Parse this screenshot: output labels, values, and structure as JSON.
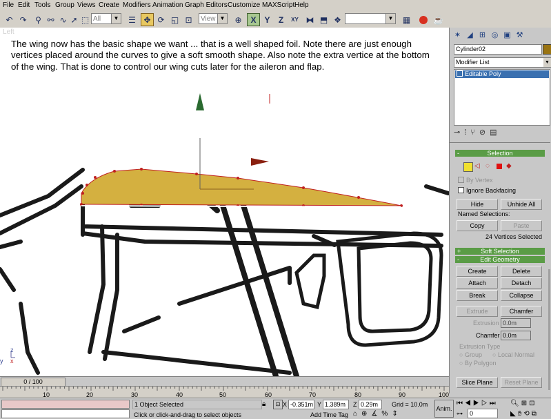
{
  "menu": [
    "File",
    "Edit",
    "Tools",
    "Group",
    "Views",
    "Create",
    "Modifiers",
    "Animation",
    "Graph Editors",
    "Customize",
    "MAXScript",
    "Help"
  ],
  "toolbar": {
    "selection_filter": "All",
    "ref_coord": "View"
  },
  "viewport": {
    "label": "Left",
    "note": "The wing now has the basic shape we want ... that is a well shaped foil.  Note there are just enough vertices placed around the curves to give a soft smooth shape.  Also note the extra vertice at the bottom of the wing.  That is done to control our wing cuts later for the aileron and flap.",
    "axis_y": "y",
    "axis_z": "z",
    "axis_x": "x"
  },
  "panel": {
    "object_name": "Cylinder02",
    "modifier_list": "Modifier List",
    "stack_item": "Editable Poly",
    "colors": {
      "object_swatch": "#9a7412",
      "rollout": "#5a9c46",
      "wing": "#d4b040"
    },
    "selection": {
      "title": "Selection",
      "by_vertex": "By Vertex",
      "ignore_backfacing": "Ignore Backfacing",
      "hide": "Hide",
      "unhide_all": "Unhide All",
      "named_selections": "Named Selections:",
      "copy": "Copy",
      "paste": "Paste",
      "status": "24 Vertices Selected"
    },
    "soft_selection": {
      "title": "Soft Selection",
      "sign": "+"
    },
    "edit_geometry": {
      "title": "Edit Geometry",
      "sign": "-",
      "create": "Create",
      "delete": "Delete",
      "attach": "Attach",
      "detach": "Detach",
      "break": "Break",
      "collapse": "Collapse",
      "extrude": "Extrude",
      "chamfer": "Chamfer",
      "extrusion_label": "Extrusion",
      "extrusion_value": "0.0m",
      "chamfer_label": "Chamfer",
      "chamfer_value": "0.0m",
      "extrusion_type": "Extrusion Type",
      "group": "Group",
      "local_normal": "Local Normal",
      "by_polygon": "By Polygon",
      "slice_plane": "Slice Plane",
      "reset_plane": "Reset Plane"
    }
  },
  "timeline": {
    "frame": "0 / 100",
    "ticks": [
      "10",
      "20",
      "30",
      "40",
      "50",
      "60",
      "70",
      "80",
      "90",
      "100"
    ]
  },
  "status": {
    "selected": "1 Object Selected",
    "prompt": "Click or click-and-drag to select objects",
    "x_value": "-0.351m",
    "y_value": "1.389m",
    "z_value": "0.29m",
    "grid": "Grid = 10.0m",
    "add_time_tag": "Add Time Tag",
    "anim": "Anim.",
    "frame_value": "0"
  }
}
